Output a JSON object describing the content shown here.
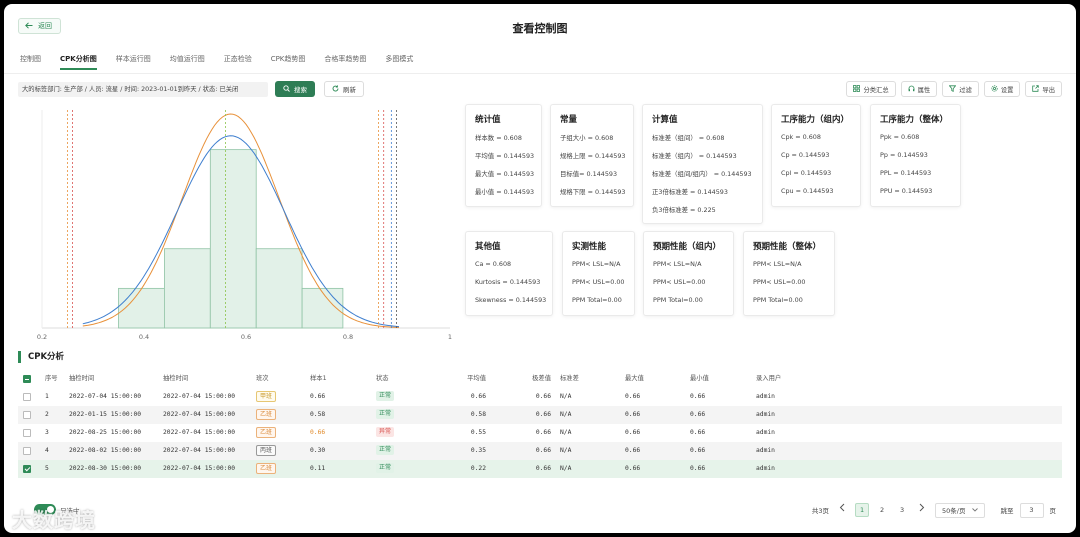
{
  "header": {
    "back_label": "返回",
    "title": "查看控制图"
  },
  "tabs": [
    "控制图",
    "CPK分析图",
    "样本运行图",
    "均值运行图",
    "正态检验",
    "CPK趋势图",
    "合格率趋势图",
    "多图模式"
  ],
  "active_tab": 1,
  "filter": {
    "text": "大的标签部门: 生产部 / 人员: 流星 / 时间: 2023-01-01到昨天 / 状态: 已关闭",
    "search_label": "搜索",
    "refresh_label": "刷新"
  },
  "toolbar": {
    "classify_label": "分类汇总",
    "attr_label": "属性",
    "filter_label": "过滤",
    "settings_label": "设置",
    "export_label": "导出"
  },
  "chart_data": {
    "type": "bar",
    "subtype": "histogram with normal curves and spec/control lines",
    "x_ticks": [
      "0.2",
      "0.4",
      "0.6",
      "0.8",
      "1"
    ],
    "xlim": [
      0.2,
      1.0
    ],
    "bins": [
      {
        "from": 0.35,
        "to": 0.44,
        "value": 2
      },
      {
        "from": 0.44,
        "to": 0.53,
        "value": 4
      },
      {
        "from": 0.53,
        "to": 0.62,
        "value": 9
      },
      {
        "from": 0.62,
        "to": 0.71,
        "value": 4
      },
      {
        "from": 0.71,
        "to": 0.79,
        "value": 2
      }
    ],
    "ylim": [
      0,
      11
    ],
    "curves": [
      {
        "color": "#e8913a",
        "mean": 0.57,
        "sd": 0.095,
        "peak": 10.8
      },
      {
        "color": "#3f7fcf",
        "mean": 0.57,
        "sd": 0.105,
        "peak": 9.7
      }
    ],
    "vlines": [
      {
        "x": 0.25,
        "color": "#e8913a"
      },
      {
        "x": 0.26,
        "color": "#d9534f"
      },
      {
        "x": 0.56,
        "color": "#8bc34a"
      },
      {
        "x": 0.86,
        "color": "#e8913a"
      },
      {
        "x": 0.87,
        "color": "#d9534f"
      },
      {
        "x": 0.885,
        "color": "#3f7fcf"
      },
      {
        "x": 0.895,
        "color": "#555555"
      }
    ],
    "grid": false
  },
  "stats": {
    "tongji": {
      "title": "统计值",
      "rows": [
        "样本数 = 0.608",
        "平均值 = 0.144593",
        "最大值 = 0.144593",
        "最小值 = 0.144593"
      ]
    },
    "changliang": {
      "title": "常量",
      "rows": [
        "子组大小 = 0.608",
        "规格上限 = 0.144593",
        "目标值= 0.144593",
        "规格下限 = 0.144593"
      ]
    },
    "jisuan": {
      "title": "计算值",
      "rows": [
        "标准差（组间） = 0.608",
        "标准差（组内） = 0.144593",
        "标准差（组间/组内） = 0.144593",
        "正3倍标准差 = 0.144593",
        "负3倍标准差  = 0.225"
      ]
    },
    "nengli_zunei": {
      "title": "工序能力（组内）",
      "rows": [
        "Cpk = 0.608",
        "Cp = 0.144593",
        "Cpl = 0.144593",
        "Cpu = 0.144593"
      ]
    },
    "nengli_zhengti": {
      "title": "工序能力（整体）",
      "rows": [
        "Ppk = 0.608",
        "Pp = 0.144593",
        "PPL = 0.144593",
        "PPU = 0.144593"
      ]
    },
    "qita": {
      "title": "其他值",
      "rows": [
        "Ca = 0.608",
        "Kurtosis = 0.144593",
        "Skewness = 0.144593"
      ]
    },
    "shice": {
      "title": "实测性能",
      "rows": [
        "PPM<  LSL=N/A",
        "PPM<  USL=0.00",
        "PPM Total=0.00"
      ]
    },
    "yuqi_zunei": {
      "title": "预期性能（组内）",
      "rows": [
        "PPM<  LSL=N/A",
        "PPM<  USL=0.00",
        "PPM Total=0.00"
      ]
    },
    "yuqi_zhengti": {
      "title": "预期性能（整体）",
      "rows": [
        "PPM<  LSL=N/A",
        "PPM<  USL=0.00",
        "PPM Total=0.00"
      ]
    }
  },
  "section": {
    "title": "CPK分析"
  },
  "table": {
    "headers": [
      "序号",
      "抽检时间",
      "抽检时间",
      "班次",
      "样本1",
      "状态",
      "平均值",
      "极差值",
      "标准差",
      "最大值",
      "最小值",
      "录入用户"
    ],
    "rows": [
      {
        "idx": "1",
        "t1": "2022-07-04 15:00:00",
        "t2": "2022-07-04 15:00:00",
        "shift": "甲班",
        "sample": "0.66",
        "status": "正常",
        "avg": "0.66",
        "range": "0.66",
        "std": "N/A",
        "max": "0.66",
        "min": "0.66",
        "user": "admin"
      },
      {
        "idx": "2",
        "t1": "2022-01-15 15:00:00",
        "t2": "2022-07-04 15:00:00",
        "shift": "乙班",
        "sample": "0.58",
        "status": "正常",
        "avg": "0.58",
        "range": "0.66",
        "std": "N/A",
        "max": "0.66",
        "min": "0.66",
        "user": "admin"
      },
      {
        "idx": "3",
        "t1": "2022-08-25 15:00:00",
        "t2": "2022-07-04 15:00:00",
        "shift": "乙班",
        "sample": "0.66",
        "status": "异常",
        "avg": "0.55",
        "range": "0.66",
        "std": "N/A",
        "max": "0.66",
        "min": "0.66",
        "user": "admin"
      },
      {
        "idx": "4",
        "t1": "2022-08-02 15:00:00",
        "t2": "2022-07-04 15:00:00",
        "shift": "丙班",
        "sample": "0.30",
        "status": "正常",
        "avg": "0.35",
        "range": "0.66",
        "std": "N/A",
        "max": "0.66",
        "min": "0.66",
        "user": "admin"
      },
      {
        "idx": "5",
        "t1": "2022-08-30 15:00:00",
        "t2": "2022-07-04 15:00:00",
        "shift": "乙班",
        "sample": "0.11",
        "status": "正常",
        "avg": "0.22",
        "range": "0.66",
        "std": "N/A",
        "max": "0.66",
        "min": "0.66",
        "user": "admin"
      }
    ]
  },
  "pager": {
    "total": "共3页",
    "pages": [
      "1",
      "2",
      "3"
    ],
    "current": "1",
    "size": "50条/页",
    "jump_label": "跳至",
    "jump_value": "3",
    "page_unit": "页"
  },
  "toggle": {
    "label": "只选中"
  },
  "watermark": "大数跨境"
}
